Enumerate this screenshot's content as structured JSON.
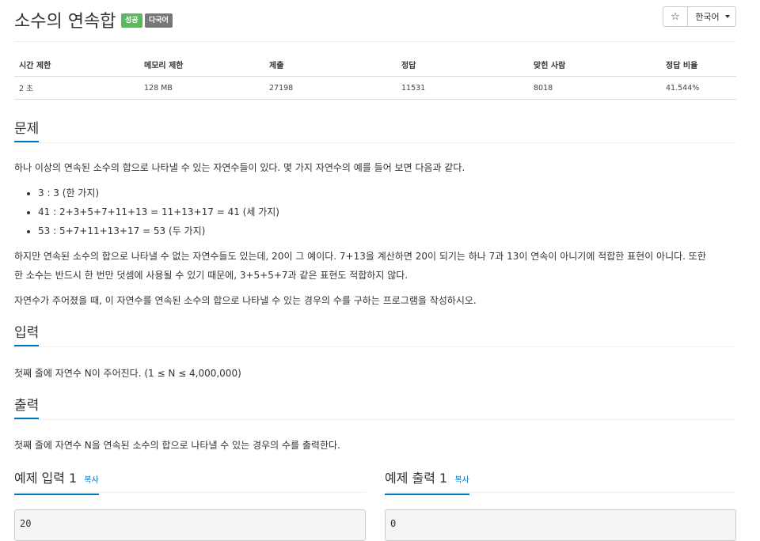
{
  "header": {
    "title": "소수의 연속합",
    "badge_success": "성공",
    "badge_multilang": "다국어",
    "star_icon": "star-icon",
    "language": "한국어"
  },
  "stats": {
    "headers": [
      "시간 제한",
      "메모리 제한",
      "제출",
      "정답",
      "맞힌 사람",
      "정답 비율"
    ],
    "values": [
      "2 초",
      "128 MB",
      "27198",
      "11531",
      "8018",
      "41.544%"
    ]
  },
  "problem": {
    "heading": "문제",
    "intro": "하나 이상의 연속된 소수의 합으로 나타낼 수 있는 자연수들이 있다. 몇 가지 자연수의 예를 들어 보면 다음과 같다.",
    "examples": [
      "3 : 3 (한 가지)",
      "41 : 2+3+5+7+11+13 = 11+13+17 = 41 (세 가지)",
      "53 : 5+7+11+13+17 = 53 (두 가지)"
    ],
    "para2_line1": "하지만 연속된 소수의 합으로 나타낼 수 없는 자연수들도 있는데, 20이 그 예이다. 7+13을 계산하면 20이 되기는 하나 7과 13이 연속이 아니기에 적합한 표현이 아니다. 또한",
    "para2_line2": "한 소수는 반드시 한 번만 덧셈에 사용될 수 있기 때문에, 3+5+5+7과 같은 표현도 적합하지 않다.",
    "para3": "자연수가 주어졌을 때, 이 자연수를 연속된 소수의 합으로 나타낼 수 있는 경우의 수를 구하는 프로그램을 작성하시오."
  },
  "input": {
    "heading": "입력",
    "text": "첫째 줄에 자연수 N이 주어진다. (1 ≤ N ≤ 4,000,000)"
  },
  "output": {
    "heading": "출력",
    "text": "첫째 줄에 자연수 N을 연속된 소수의 합으로 나타낼 수 있는 경우의 수를 출력한다."
  },
  "samples": {
    "input_title": "예제 입력 1",
    "output_title": "예제 출력 1",
    "copy_label": "복사",
    "input_value": "20",
    "output_value": "0"
  }
}
